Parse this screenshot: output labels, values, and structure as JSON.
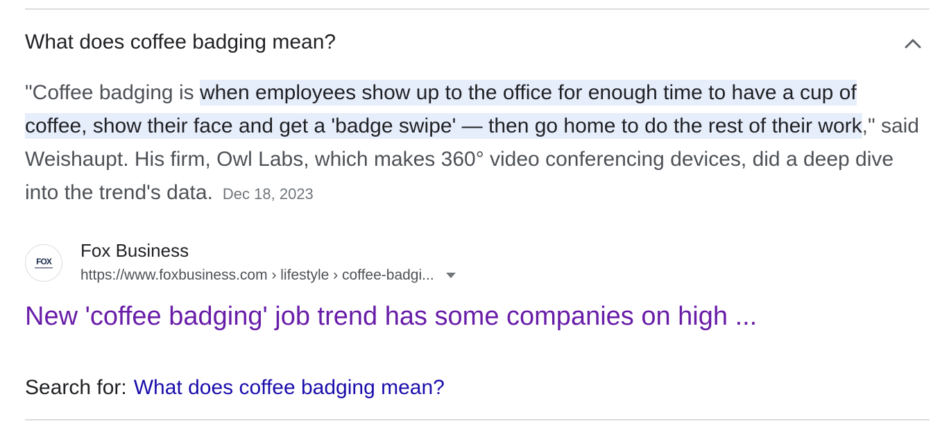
{
  "faq": {
    "question": "What does coffee badging mean?",
    "expand_icon": "chevron-up-icon"
  },
  "snippet": {
    "before_highlight": "\"Coffee badging is ",
    "highlight": "when employees show up to the office for enough time to have a cup of coffee, show their face and get a 'badge swipe' — then go home to do the rest of their work",
    "after_highlight": ",\" said Weishaupt. His firm, Owl Labs, which makes 360° video conferencing devices, did a deep dive into the trend's data.",
    "date": "Dec 18, 2023"
  },
  "source": {
    "favicon_text": "FOX",
    "name": "Fox Business",
    "url": "https://www.foxbusiness.com › lifestyle › coffee-badgi...",
    "menu_icon": "triangle-down-icon"
  },
  "result": {
    "title": "New 'coffee badging' job trend has some companies on high ..."
  },
  "search_for": {
    "label": "Search for:",
    "query": "What does coffee badging mean?"
  },
  "colors": {
    "link_visited": "#681da8",
    "link": "#1a0dab",
    "highlight": "#e6edfb",
    "text_secondary": "#4d5156"
  }
}
